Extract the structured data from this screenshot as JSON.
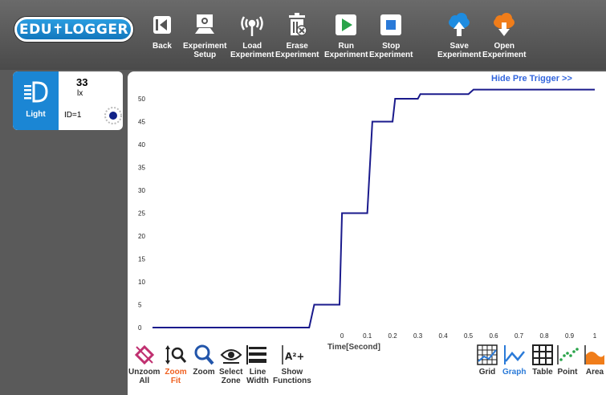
{
  "app": {
    "logo": "EDU✝LOGGER"
  },
  "toolbar": [
    {
      "label": "Back",
      "icon": "back-icon"
    },
    {
      "label": "Experiment\nSetup",
      "icon": "setup-icon"
    },
    {
      "label": "Load\nExperiment",
      "icon": "antenna-icon"
    },
    {
      "label": "Erase\nExperiment",
      "icon": "trash-icon"
    },
    {
      "label": "Run\nExperiment",
      "icon": "play-icon"
    },
    {
      "label": "Stop\nExperiment",
      "icon": "stop-icon"
    },
    {
      "label": "Save\nExperiment",
      "icon": "cloud-upload-icon"
    },
    {
      "label": "Open\nExperiment",
      "icon": "cloud-download-icon"
    }
  ],
  "sensor": {
    "value": "33",
    "unit": "lx",
    "name": "Light",
    "id": "ID=1"
  },
  "chart": {
    "hide_pre_trigger": "Hide Pre Trigger >>"
  },
  "chart_data": {
    "type": "line",
    "xlabel": "Time[Second]",
    "xlim": [
      -0.75,
      1.0
    ],
    "ylim": [
      -1,
      54
    ],
    "x_ticks": [
      "0",
      "0.1",
      "0.2",
      "0.3",
      "0.4",
      "0.5",
      "0.6",
      "0.7",
      "0.8",
      "0.9",
      "1"
    ],
    "y_ticks": [
      "0",
      "5",
      "10",
      "15",
      "20",
      "25",
      "30",
      "35",
      "40",
      "45",
      "50"
    ],
    "grid": false,
    "color": "#1a1a8c",
    "series": [
      {
        "points": [
          [
            -0.75,
            0
          ],
          [
            -0.13,
            0
          ],
          [
            -0.11,
            5
          ],
          [
            -0.01,
            5
          ],
          [
            0.0,
            25
          ],
          [
            0.1,
            25
          ],
          [
            0.12,
            45
          ],
          [
            0.2,
            45
          ],
          [
            0.21,
            50
          ],
          [
            0.3,
            50
          ],
          [
            0.31,
            51
          ],
          [
            0.5,
            51
          ],
          [
            0.52,
            52
          ],
          [
            1.0,
            52
          ]
        ]
      }
    ]
  },
  "bottom_left": [
    {
      "label": "Unzoom\nAll",
      "icon": "unzoom-icon"
    },
    {
      "label": "Zoom\nFit",
      "icon": "zoom-fit-icon",
      "state": "active"
    },
    {
      "label": "Zoom",
      "icon": "zoom-icon"
    },
    {
      "label": "Select\nZone",
      "icon": "eye-icon"
    },
    {
      "label": "Line\nWidth",
      "icon": "line-width-icon"
    },
    {
      "label": "Show\nFunctions",
      "icon": "functions-icon"
    }
  ],
  "bottom_right": [
    {
      "label": "Grid",
      "icon": "grid-icon"
    },
    {
      "label": "Graph",
      "icon": "graph-icon",
      "state": "selected"
    },
    {
      "label": "Table",
      "icon": "table-icon"
    },
    {
      "label": "Point",
      "icon": "point-icon"
    },
    {
      "label": "Area",
      "icon": "area-icon"
    }
  ]
}
